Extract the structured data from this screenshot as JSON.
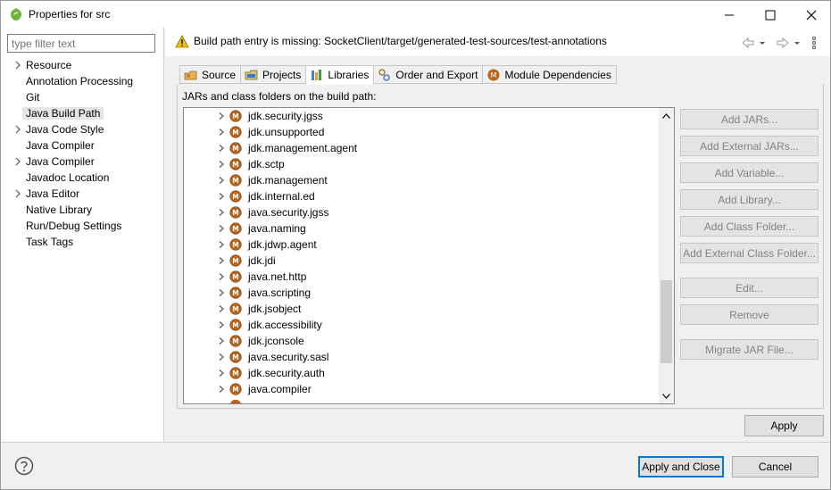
{
  "window": {
    "title": "Properties for src",
    "app_icon": "eclipse-icon",
    "buttons": [
      "minimize-icon",
      "maximize-icon",
      "close-icon"
    ]
  },
  "left": {
    "filter_placeholder": "type filter text",
    "items": [
      {
        "label": "Resource",
        "expandable": true,
        "selected": false
      },
      {
        "label": "Annotation Processing",
        "expandable": false,
        "selected": false
      },
      {
        "label": "Git",
        "expandable": false,
        "selected": false
      },
      {
        "label": "Java Build Path",
        "expandable": false,
        "selected": true
      },
      {
        "label": "Java Code Style",
        "expandable": true,
        "selected": false
      },
      {
        "label": "Java Compiler",
        "expandable": false,
        "selected": false
      },
      {
        "label": "Java Compiler",
        "expandable": true,
        "selected": false
      },
      {
        "label": "Javadoc Location",
        "expandable": false,
        "selected": false
      },
      {
        "label": "Java Editor",
        "expandable": true,
        "selected": false
      },
      {
        "label": "Native Library",
        "expandable": false,
        "selected": false
      },
      {
        "label": "Run/Debug Settings",
        "expandable": false,
        "selected": false
      },
      {
        "label": "Task Tags",
        "expandable": false,
        "selected": false
      }
    ]
  },
  "header": {
    "warning": "Build path entry is missing: SocketClient/target/generated-test-sources/test-annotations",
    "nav_icons": [
      "back-arrow-icon",
      "back-menu-icon",
      "forward-arrow-icon",
      "forward-menu-icon",
      "view-menu-icon"
    ]
  },
  "tabs": [
    {
      "label": "Source",
      "icon": "source-folder-icon",
      "active": false
    },
    {
      "label": "Projects",
      "icon": "projects-icon",
      "active": false
    },
    {
      "label": "Libraries",
      "icon": "libraries-icon",
      "active": true
    },
    {
      "label": "Order and Export",
      "icon": "order-export-icon",
      "active": false
    },
    {
      "label": "Module Dependencies",
      "icon": "module-icon",
      "active": false
    }
  ],
  "libraries": {
    "label": "JARs and class folders on the build path:",
    "entries": [
      "jdk.security.jgss",
      "jdk.unsupported",
      "jdk.management.agent",
      "jdk.sctp",
      "jdk.management",
      "jdk.internal.ed",
      "java.security.jgss",
      "java.naming",
      "jdk.jdwp.agent",
      "jdk.jdi",
      "java.net.http",
      "java.scripting",
      "jdk.jsobject",
      "jdk.accessibility",
      "jdk.jconsole",
      "java.security.sasl",
      "jdk.security.auth",
      "java.compiler"
    ],
    "buttons": [
      "Add JARs...",
      "Add External JARs...",
      "Add Variable...",
      "Add Library...",
      "Add Class Folder...",
      "Add External Class Folder...",
      "Edit...",
      "Remove",
      "Migrate JAR File..."
    ]
  },
  "apply_label": "Apply",
  "footer": {
    "help_icon": "help-icon",
    "apply_close_label": "Apply and Close",
    "cancel_label": "Cancel"
  },
  "colors": {
    "module_icon": "#b5651d",
    "warning_icon": "#f2c200",
    "default_button_border": "#0078d7"
  }
}
